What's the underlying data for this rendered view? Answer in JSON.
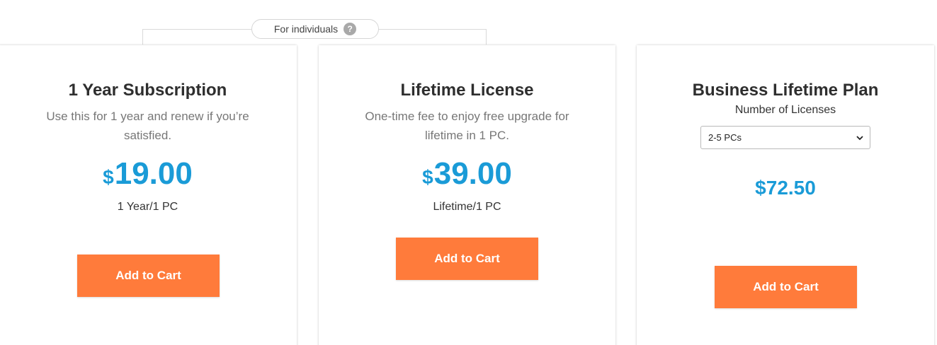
{
  "badge": {
    "label": "For individuals",
    "help_icon": "question-circle-icon",
    "help_glyph": "?"
  },
  "plans": [
    {
      "title": "1 Year Subscription",
      "description": "Use this for 1 year and renew if you’re satisfied.",
      "currency": "$",
      "price": "19.00",
      "period": "1 Year/1 PC",
      "button": "Add to Cart"
    },
    {
      "title": "Lifetime License",
      "description": "One-time fee to enjoy free upgrade for lifetime in 1 PC.",
      "currency": "$",
      "price": "39.00",
      "period": "Lifetime/1 PC",
      "button": "Add to Cart"
    },
    {
      "title": "Business Lifetime Plan",
      "licenses_label": "Number of Licenses",
      "licenses_selected": "2-5 PCs",
      "price": "$72.50",
      "button": "Add to Cart"
    }
  ],
  "colors": {
    "accent_price": "#1a9bd7",
    "button": "#ff7b3b"
  }
}
